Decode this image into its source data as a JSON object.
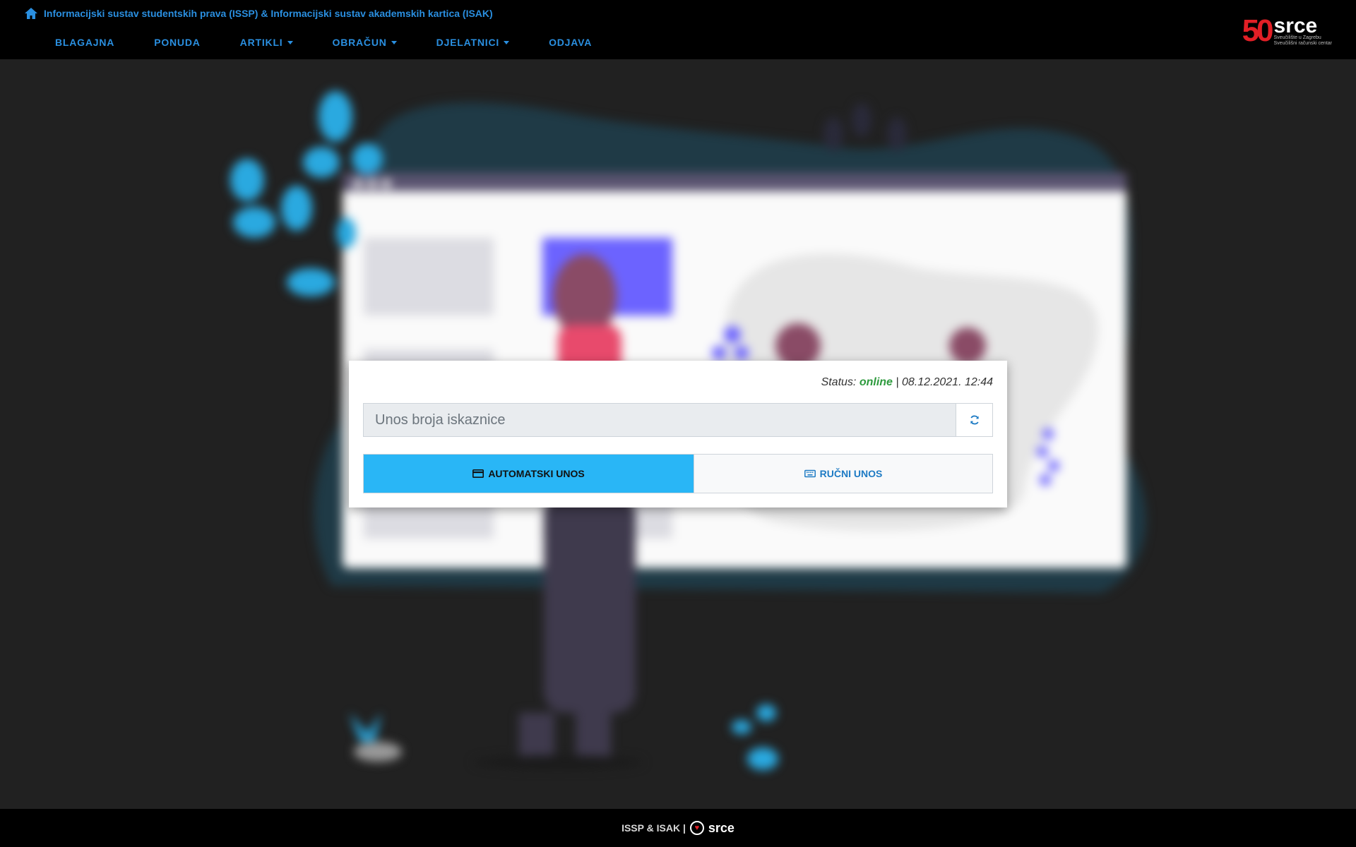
{
  "header": {
    "title": "Informacijski sustav studentskih prava (ISSP) & Informacijski sustav akademskih kartica (ISAK)",
    "home_icon": "home-icon",
    "nav": [
      {
        "label": "BLAGAJNA",
        "dropdown": false
      },
      {
        "label": "PONUDA",
        "dropdown": false
      },
      {
        "label": "ARTIKLI",
        "dropdown": true
      },
      {
        "label": "OBRAČUN",
        "dropdown": true
      },
      {
        "label": "DJELATNICI",
        "dropdown": true
      },
      {
        "label": "ODJAVA",
        "dropdown": false
      }
    ],
    "logo": {
      "number": "50",
      "name": "srce",
      "line1": "Sveučilište u Zagrebu",
      "line2": "Sveučilišni računski centar"
    }
  },
  "card": {
    "status_label": "Status:",
    "status_value": "online",
    "status_datetime": "| 08.12.2021. 12:44",
    "input_placeholder": "Unos broja iskaznice",
    "auto_label": "AUTOMATSKI UNOS",
    "manual_label": "RUČNI UNOS"
  },
  "footer": {
    "text": "ISSP & ISAK |",
    "brand": "srce"
  },
  "colors": {
    "accent": "#2a8fe0",
    "primary_button": "#29b6f6",
    "online": "#2e9b3e",
    "logo_red": "#e21f26"
  }
}
